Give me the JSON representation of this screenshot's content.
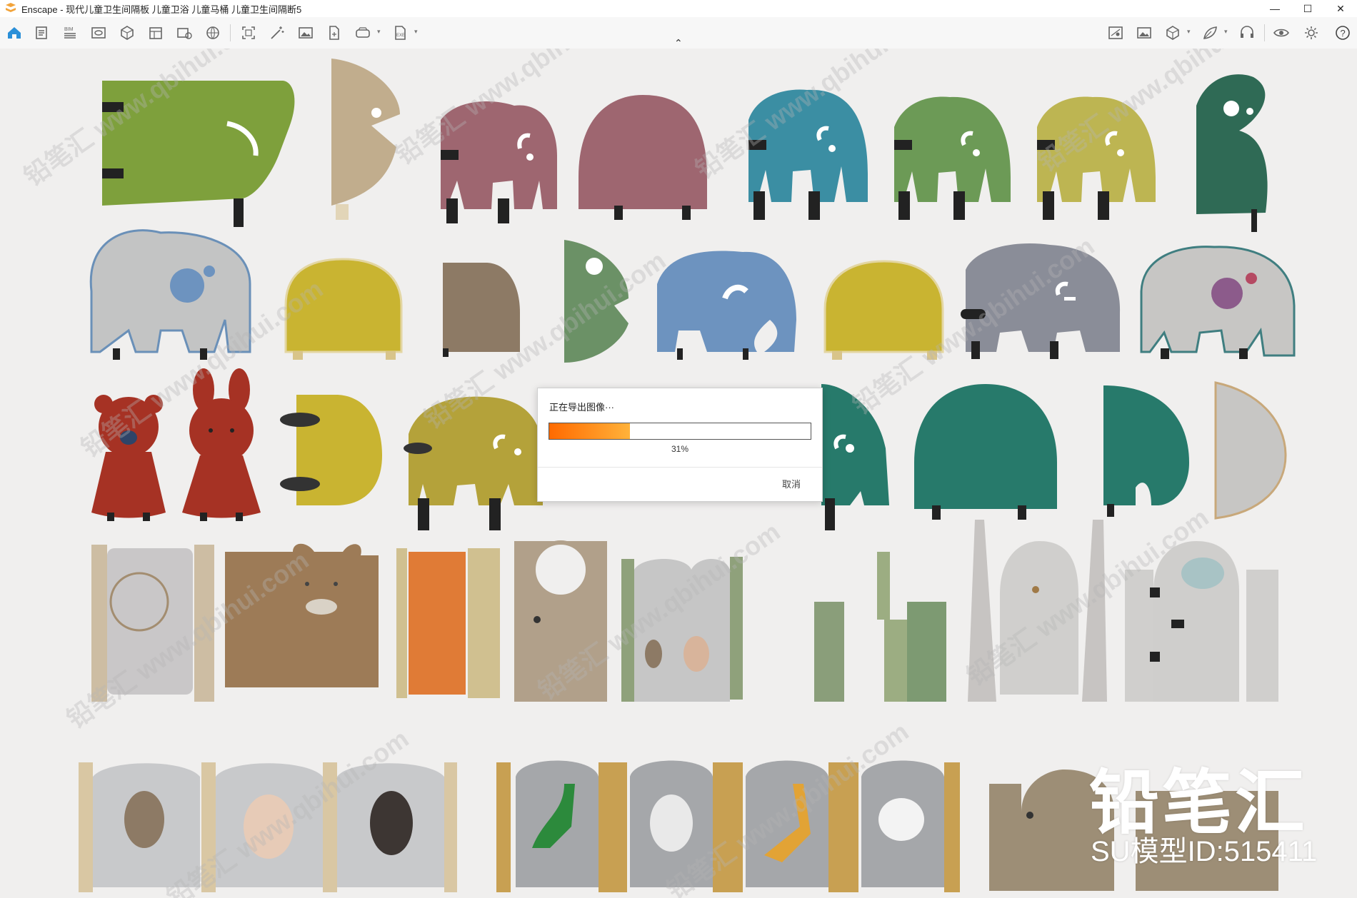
{
  "window": {
    "title": "Enscape - 现代儿童卫生间隔板 儿童卫浴 儿童马桶 儿童卫生间隔断5",
    "minimize": "—",
    "maximize": "☐",
    "close": "✕"
  },
  "toolbar": {
    "left_icons": [
      "home-icon",
      "document-icon",
      "bim-icon",
      "eye-panel-icon",
      "cube-icon",
      "layers-icon",
      "screenshot-settings-icon",
      "globe-settings-icon",
      "frame-icon",
      "magic-wand-icon",
      "image-icon",
      "file-export-icon",
      "vr-headset-icon",
      "exe-export-icon"
    ],
    "right_icons": [
      "map-icon",
      "image-gallery-icon",
      "box-icon",
      "leaf-icon",
      "headset-icon",
      "eye-icon",
      "settings-gear-icon",
      "help-icon"
    ],
    "collapse": "⌃"
  },
  "dialog": {
    "title": "正在导出图像···",
    "progress_percent": 31,
    "progress_label": "31%",
    "cancel_label": "取消"
  },
  "watermark": {
    "brand": "铅笔汇",
    "model_id": "SU模型ID:515411",
    "tile_text": "铅笔汇 www.qbihui.com"
  },
  "colors": {
    "accent_orange": "#ff6a00",
    "olive_green": "#7ea03c",
    "rose": "#9e6670",
    "teal_blue": "#3b8ea3",
    "sage": "#6c9a56",
    "mustard": "#bdb552",
    "dark_green": "#2f6a55",
    "grey": "#c3c4c4",
    "yellow": "#c9b431",
    "wood": "#8d7a65",
    "blue": "#6d93bf",
    "slate": "#8a8d98",
    "red": "#a63224",
    "teal": "#277a6b",
    "light_grey": "#c7c6c4"
  }
}
